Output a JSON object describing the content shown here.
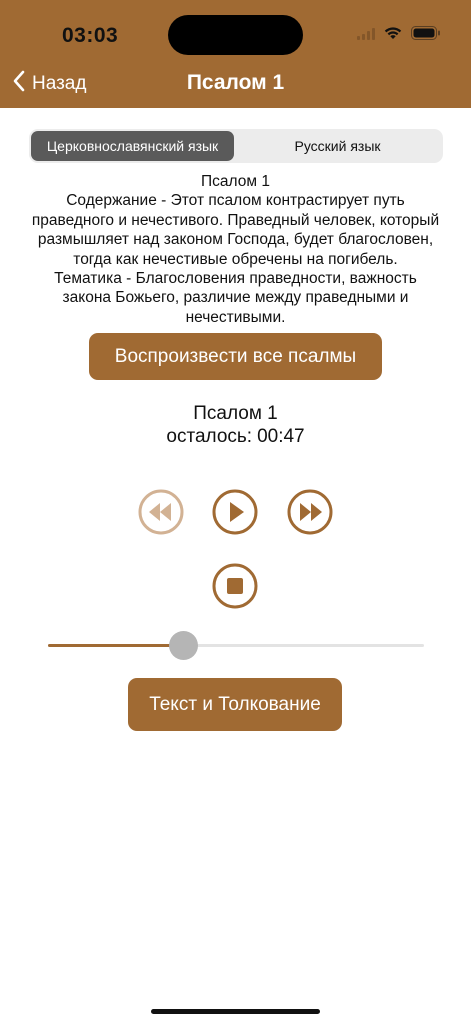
{
  "status_bar": {
    "time": "03:03"
  },
  "nav": {
    "back_label": "Назад",
    "title": "Псалом 1"
  },
  "tabs": [
    {
      "label": "Церковнославянский язык",
      "selected": true
    },
    {
      "label": "Русский язык",
      "selected": false
    }
  ],
  "description": {
    "heading": "Псалом 1",
    "lines": [
      "Содержание - Этот псалом контрастирует путь",
      "праведного и нечестивого. Праведный человек, который",
      "размышляет над законом Господа, будет благословен,",
      "тогда как нечестивые обречены на погибель.",
      "Тематика - Благословения праведности, важность",
      "закона Божьего, различие между праведными и",
      "нечестивыми."
    ]
  },
  "play_all_label": "Воспроизвести все псалмы",
  "player": {
    "track_name": "Псалом 1",
    "remaining_label": "осталось:",
    "remaining_time": "00:47",
    "progress": 0.36,
    "controls": {
      "rewind_icon": "rewind-icon",
      "play_icon": "play-icon",
      "forward_icon": "fast-forward-icon",
      "stop_icon": "stop-icon"
    }
  },
  "text_button_label": "Текст и Толкование",
  "colors": {
    "accent": "#a06a33",
    "accent_disabled": "#d2b294",
    "segment_active": "#5a5a5a"
  }
}
